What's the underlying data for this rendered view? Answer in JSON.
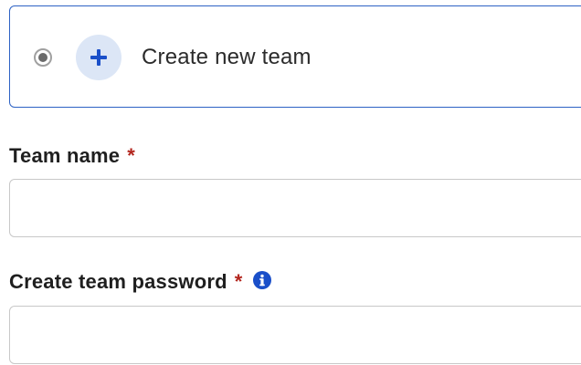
{
  "create_option": {
    "label": "Create new team",
    "selected": true,
    "icon": "plus-icon"
  },
  "team_name": {
    "label": "Team name",
    "required_marker": "*",
    "value": "",
    "placeholder": ""
  },
  "team_password": {
    "label": "Create team password",
    "required_marker": "*",
    "info_icon": "info-icon",
    "value": "",
    "placeholder": ""
  },
  "colors": {
    "accent": "#2d62c4",
    "required": "#b3261e",
    "icon_bg": "#dce6f6",
    "info": "#1a4fc9"
  }
}
